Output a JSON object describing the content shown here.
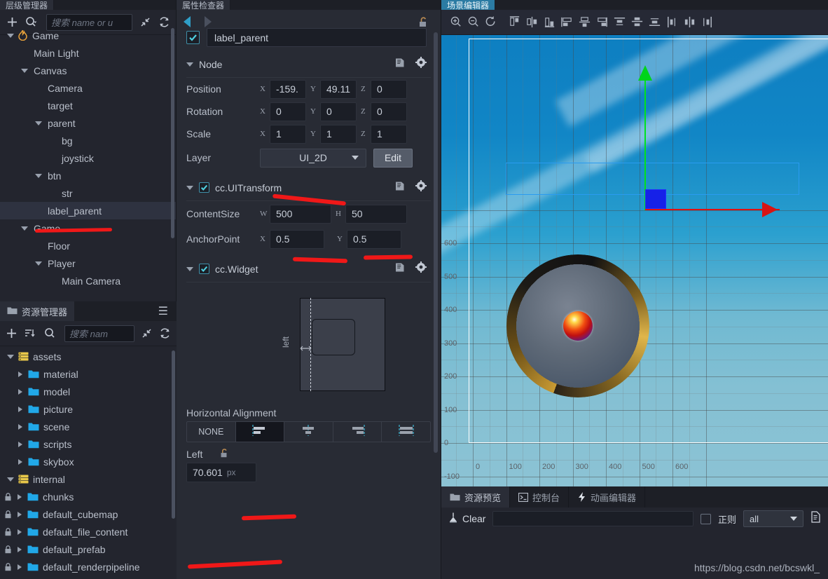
{
  "tabs": {
    "hierarchy": "层级管理器",
    "inspector": "属性检查器",
    "scene": "场景编辑器"
  },
  "hierarchy": {
    "search_placeholder": "搜索 name or u",
    "add_icon": "plus-icon",
    "search_icon": "search-icon",
    "collapse_icon": "collapse-icon",
    "refresh_icon": "refresh-icon",
    "items": [
      {
        "label": "Game",
        "depth": 0,
        "arrow": "down",
        "icon": "flame-icon",
        "selected": false
      },
      {
        "label": "Main Light",
        "depth": 1,
        "arrow": "none",
        "icon": "",
        "selected": false
      },
      {
        "label": "Canvas",
        "depth": 1,
        "arrow": "down",
        "icon": "",
        "selected": false
      },
      {
        "label": "Camera",
        "depth": 2,
        "arrow": "none",
        "icon": "",
        "selected": false
      },
      {
        "label": "target",
        "depth": 2,
        "arrow": "none",
        "icon": "",
        "selected": false
      },
      {
        "label": "parent",
        "depth": 2,
        "arrow": "down",
        "icon": "",
        "selected": false
      },
      {
        "label": "bg",
        "depth": 3,
        "arrow": "none",
        "icon": "",
        "selected": false
      },
      {
        "label": "joystick",
        "depth": 3,
        "arrow": "none",
        "icon": "",
        "selected": false
      },
      {
        "label": "btn",
        "depth": 2,
        "arrow": "down",
        "icon": "",
        "selected": false
      },
      {
        "label": "str",
        "depth": 3,
        "arrow": "none",
        "icon": "",
        "selected": false
      },
      {
        "label": "label_parent",
        "depth": 2,
        "arrow": "none",
        "icon": "",
        "selected": true
      },
      {
        "label": "Game",
        "depth": 1,
        "arrow": "down",
        "icon": "",
        "selected": false
      },
      {
        "label": "Floor",
        "depth": 2,
        "arrow": "none",
        "icon": "",
        "selected": false
      },
      {
        "label": "Player",
        "depth": 2,
        "arrow": "down",
        "icon": "",
        "selected": false
      },
      {
        "label": "Main Camera",
        "depth": 3,
        "arrow": "none",
        "icon": "",
        "selected": false
      }
    ]
  },
  "assets": {
    "title": "资源管理器",
    "menu_icon": "hamburger-icon",
    "search_placeholder": "搜索 nam",
    "add_icon": "plus-icon",
    "sort_icon": "sort-icon",
    "search_icon": "search-icon",
    "collapse_icon": "collapse-icon",
    "refresh_icon": "refresh-icon",
    "items": [
      {
        "label": "assets",
        "depth": 0,
        "arrow": "down",
        "kind": "db",
        "locked": false
      },
      {
        "label": "material",
        "depth": 1,
        "arrow": "right",
        "kind": "folder",
        "locked": false
      },
      {
        "label": "model",
        "depth": 1,
        "arrow": "right",
        "kind": "folder",
        "locked": false
      },
      {
        "label": "picture",
        "depth": 1,
        "arrow": "right",
        "kind": "folder",
        "locked": false
      },
      {
        "label": "scene",
        "depth": 1,
        "arrow": "right",
        "kind": "folder",
        "locked": false
      },
      {
        "label": "scripts",
        "depth": 1,
        "arrow": "right",
        "kind": "folder",
        "locked": false
      },
      {
        "label": "skybox",
        "depth": 1,
        "arrow": "right",
        "kind": "folder",
        "locked": false
      },
      {
        "label": "internal",
        "depth": 0,
        "arrow": "down",
        "kind": "db",
        "locked": false
      },
      {
        "label": "chunks",
        "depth": 1,
        "arrow": "right",
        "kind": "folder",
        "locked": true
      },
      {
        "label": "default_cubemap",
        "depth": 1,
        "arrow": "right",
        "kind": "folder",
        "locked": true
      },
      {
        "label": "default_file_content",
        "depth": 1,
        "arrow": "right",
        "kind": "folder",
        "locked": true
      },
      {
        "label": "default_prefab",
        "depth": 1,
        "arrow": "right",
        "kind": "folder",
        "locked": true
      },
      {
        "label": "default_renderpipeline",
        "depth": 1,
        "arrow": "right",
        "kind": "folder",
        "locked": true
      }
    ]
  },
  "inspector": {
    "prev_icon": "arrow-left-icon",
    "next_icon": "arrow-right-icon",
    "lock_icon": "unlock-icon",
    "node_name": "label_parent",
    "node_enabled": true,
    "node_section": {
      "title": "Node",
      "help_icon": "book-icon",
      "settings_icon": "gear-icon",
      "position": {
        "label": "Position",
        "x": "-159.",
        "y": "49.11",
        "z": "0"
      },
      "rotation": {
        "label": "Rotation",
        "x": "0",
        "y": "0",
        "z": "0"
      },
      "scale": {
        "label": "Scale",
        "x": "1",
        "y": "1",
        "z": "1"
      },
      "layer": {
        "label": "Layer",
        "value": "UI_2D",
        "edit_label": "Edit"
      }
    },
    "uitransform": {
      "title": "cc.UITransform",
      "enabled": true,
      "help_icon": "book-icon",
      "settings_icon": "gear-icon",
      "content_size": {
        "label": "ContentSize",
        "w": "500",
        "h": "50"
      },
      "anchor_point": {
        "label": "AnchorPoint",
        "x": "0.5",
        "y": "0.5"
      }
    },
    "widget": {
      "title": "cc.Widget",
      "enabled": true,
      "help_icon": "book-icon",
      "settings_icon": "gear-icon",
      "diagram_label": "left",
      "halign_title": "Horizontal Alignment",
      "halign_options": [
        "NONE",
        "align-left",
        "align-center",
        "align-right",
        "align-stretch"
      ],
      "halign_selected_index": 1,
      "left_label": "Left",
      "left_lock_icon": "unlock-icon",
      "left_value": "70.601",
      "left_unit": "px"
    },
    "axis_labels": {
      "x": "X",
      "y": "Y",
      "z": "Z",
      "w": "W",
      "h": "H"
    }
  },
  "scene": {
    "toolbar_icons": [
      "zoom-in-icon",
      "zoom-out-icon",
      "reset-view-icon",
      "align-top-icon",
      "align-vcenter-icon",
      "align-bottom-icon",
      "align-left-icon",
      "align-hcenter-icon",
      "align-right-icon",
      "distribute-top-icon",
      "distribute-vcenter-icon",
      "distribute-bottom-icon",
      "distribute-left-icon",
      "distribute-hcenter-icon",
      "distribute-right-icon"
    ],
    "ruler_x": [
      "0",
      "100",
      "200",
      "300",
      "400",
      "500",
      "600"
    ],
    "ruler_y": [
      "600",
      "500",
      "400",
      "300",
      "200",
      "100",
      "0",
      "-100"
    ],
    "gizmo": {
      "x_axis_color": "#e01010",
      "y_axis_color": "#00d41b",
      "handle_color": "#1621e8"
    },
    "canvas_border_color": "#ffffff",
    "node_border_color": "#2a9bf0"
  },
  "console": {
    "tabs": [
      {
        "label": "资源预览",
        "icon": "folder-icon",
        "active": true
      },
      {
        "label": "控制台",
        "icon": "terminal-icon",
        "active": false
      },
      {
        "label": "动画编辑器",
        "icon": "bolt-icon",
        "active": false
      }
    ],
    "clear_label": "Clear",
    "clear_icon": "broom-icon",
    "filter_value": "",
    "regex_label": "正则",
    "regex_checked": false,
    "level_value": "all",
    "doc_icon": "document-icon"
  },
  "watermark": "https://blog.csdn.net/bcswkl_",
  "colors": {
    "accent": "#2f9ec7",
    "annotation_red": "#f01818",
    "selection": "#2e3240",
    "gold": "#c89a33"
  }
}
